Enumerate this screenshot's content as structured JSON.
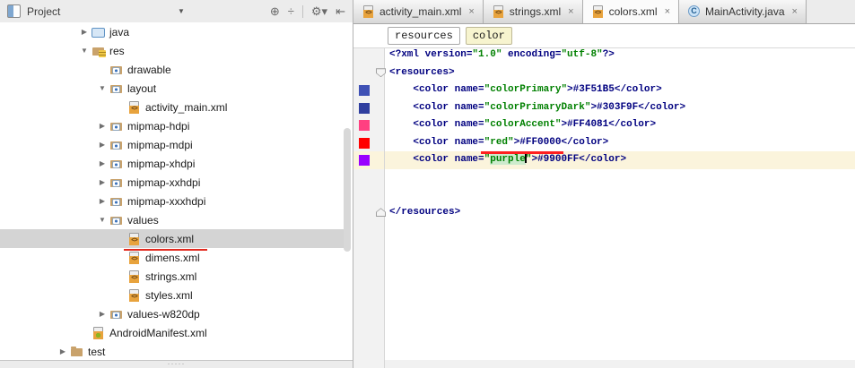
{
  "project_panel": {
    "title": "Project",
    "selector_caret_glyph": "▼",
    "toolbar": [
      {
        "name": "locate-icon",
        "glyph": "⊕"
      },
      {
        "name": "collapse-all-icon",
        "glyph": "÷"
      },
      {
        "name": "divider",
        "glyph": ""
      },
      {
        "name": "settings-gear-icon",
        "glyph": "⚙▾"
      },
      {
        "name": "hide-panel-icon",
        "glyph": "⇤"
      }
    ],
    "grip_glyph": "·····",
    "arrow_glyphs": {
      "expanded": "▼",
      "collapsed": "▶"
    },
    "tree": [
      {
        "label": "java",
        "icon": "folder-blue",
        "arrow": "collapsed",
        "indent": 86
      },
      {
        "label": "res",
        "icon": "folder-res",
        "arrow": "expanded",
        "indent": 86
      },
      {
        "label": "drawable",
        "icon": "folder-restype",
        "arrow": null,
        "indent": 106
      },
      {
        "label": "layout",
        "icon": "folder-restype",
        "arrow": "expanded",
        "indent": 106
      },
      {
        "label": "activity_main.xml",
        "icon": "xml-file",
        "arrow": null,
        "indent": 126
      },
      {
        "label": "mipmap-hdpi",
        "icon": "folder-restype",
        "arrow": "collapsed",
        "indent": 106
      },
      {
        "label": "mipmap-mdpi",
        "icon": "folder-restype",
        "arrow": "collapsed",
        "indent": 106
      },
      {
        "label": "mipmap-xhdpi",
        "icon": "folder-restype",
        "arrow": "collapsed",
        "indent": 106
      },
      {
        "label": "mipmap-xxhdpi",
        "icon": "folder-restype",
        "arrow": "collapsed",
        "indent": 106
      },
      {
        "label": "mipmap-xxxhdpi",
        "icon": "folder-restype",
        "arrow": "collapsed",
        "indent": 106
      },
      {
        "label": "values",
        "icon": "folder-restype",
        "arrow": "expanded",
        "indent": 106
      },
      {
        "label": "colors.xml",
        "icon": "xml-file",
        "arrow": null,
        "indent": 126,
        "selected": true,
        "underline": true
      },
      {
        "label": "dimens.xml",
        "icon": "xml-file",
        "arrow": null,
        "indent": 126
      },
      {
        "label": "strings.xml",
        "icon": "xml-file",
        "arrow": null,
        "indent": 126
      },
      {
        "label": "styles.xml",
        "icon": "xml-file",
        "arrow": null,
        "indent": 126
      },
      {
        "label": "values-w820dp",
        "icon": "folder-restype",
        "arrow": "collapsed",
        "indent": 106
      },
      {
        "label": "AndroidManifest.xml",
        "icon": "manifest-file",
        "arrow": null,
        "indent": 86
      },
      {
        "label": "test",
        "icon": "folder-plain",
        "arrow": "collapsed",
        "indent": 62
      }
    ]
  },
  "editor": {
    "tabs": [
      {
        "label": "activity_main.xml",
        "icon": "xml-file",
        "active": false
      },
      {
        "label": "strings.xml",
        "icon": "xml-file",
        "active": false
      },
      {
        "label": "colors.xml",
        "icon": "xml-file",
        "active": true
      },
      {
        "label": "MainActivity.java",
        "icon": "java-class",
        "active": false
      }
    ],
    "tab_close_glyph": "×",
    "breadcrumbs": [
      {
        "label": "resources",
        "active": false
      },
      {
        "label": "color",
        "active": true
      }
    ],
    "gutter_swatches": [
      {
        "line": 2,
        "color": "#3F51B5"
      },
      {
        "line": 3,
        "color": "#303F9F"
      },
      {
        "line": 4,
        "color": "#FF4081"
      },
      {
        "line": 5,
        "color": "#FF0000"
      },
      {
        "line": 6,
        "color": "#9900FF"
      }
    ],
    "caret_line": 6,
    "code": {
      "lines": [
        {
          "tokens": [
            [
              "tag",
              "<?xml version="
            ],
            [
              "val",
              "\"1.0\""
            ],
            [
              "tag",
              " encoding="
            ],
            [
              "val",
              "\"utf-8\""
            ],
            [
              "tag",
              "?>"
            ]
          ]
        },
        {
          "fold": "down",
          "tokens": [
            [
              "tag",
              "<resources>"
            ]
          ]
        },
        {
          "tokens": [
            [
              "tag",
              "    <color name="
            ],
            [
              "val",
              "\"colorPrimary\""
            ],
            [
              "tag",
              ">#3F51B5</color>"
            ]
          ]
        },
        {
          "tokens": [
            [
              "tag",
              "    <color name="
            ],
            [
              "val",
              "\"colorPrimaryDark\""
            ],
            [
              "tag",
              ">#303F9F</color>"
            ]
          ]
        },
        {
          "tokens": [
            [
              "tag",
              "    <color name="
            ],
            [
              "val",
              "\"colorAccent\""
            ],
            [
              "tag",
              ">#FF4081</color>"
            ]
          ]
        },
        {
          "tokens": [
            [
              "tag",
              "    <color name="
            ],
            [
              "val",
              "\"red\""
            ],
            [
              "tag",
              ">#FF0000</color>"
            ]
          ]
        },
        {
          "tokens": [
            [
              "tag",
              "    <color name="
            ],
            [
              "val",
              "\""
            ],
            [
              "valhl",
              "purple"
            ],
            [
              "caret",
              ""
            ],
            [
              "val",
              "\""
            ],
            [
              "tag",
              ">#9900FF</color>"
            ]
          ]
        },
        {
          "tokens": []
        },
        {
          "tokens": []
        },
        {
          "fold": "up",
          "tokens": [
            [
              "tag",
              "</resources>"
            ]
          ]
        }
      ]
    },
    "colors": {
      "caret_row_bg": "#FBF4DC",
      "tree_selection_bg": "#D4D4D4",
      "annotation_red": "#FF1F1F",
      "xml_tag": "#000080",
      "xml_value": "#008000"
    }
  }
}
